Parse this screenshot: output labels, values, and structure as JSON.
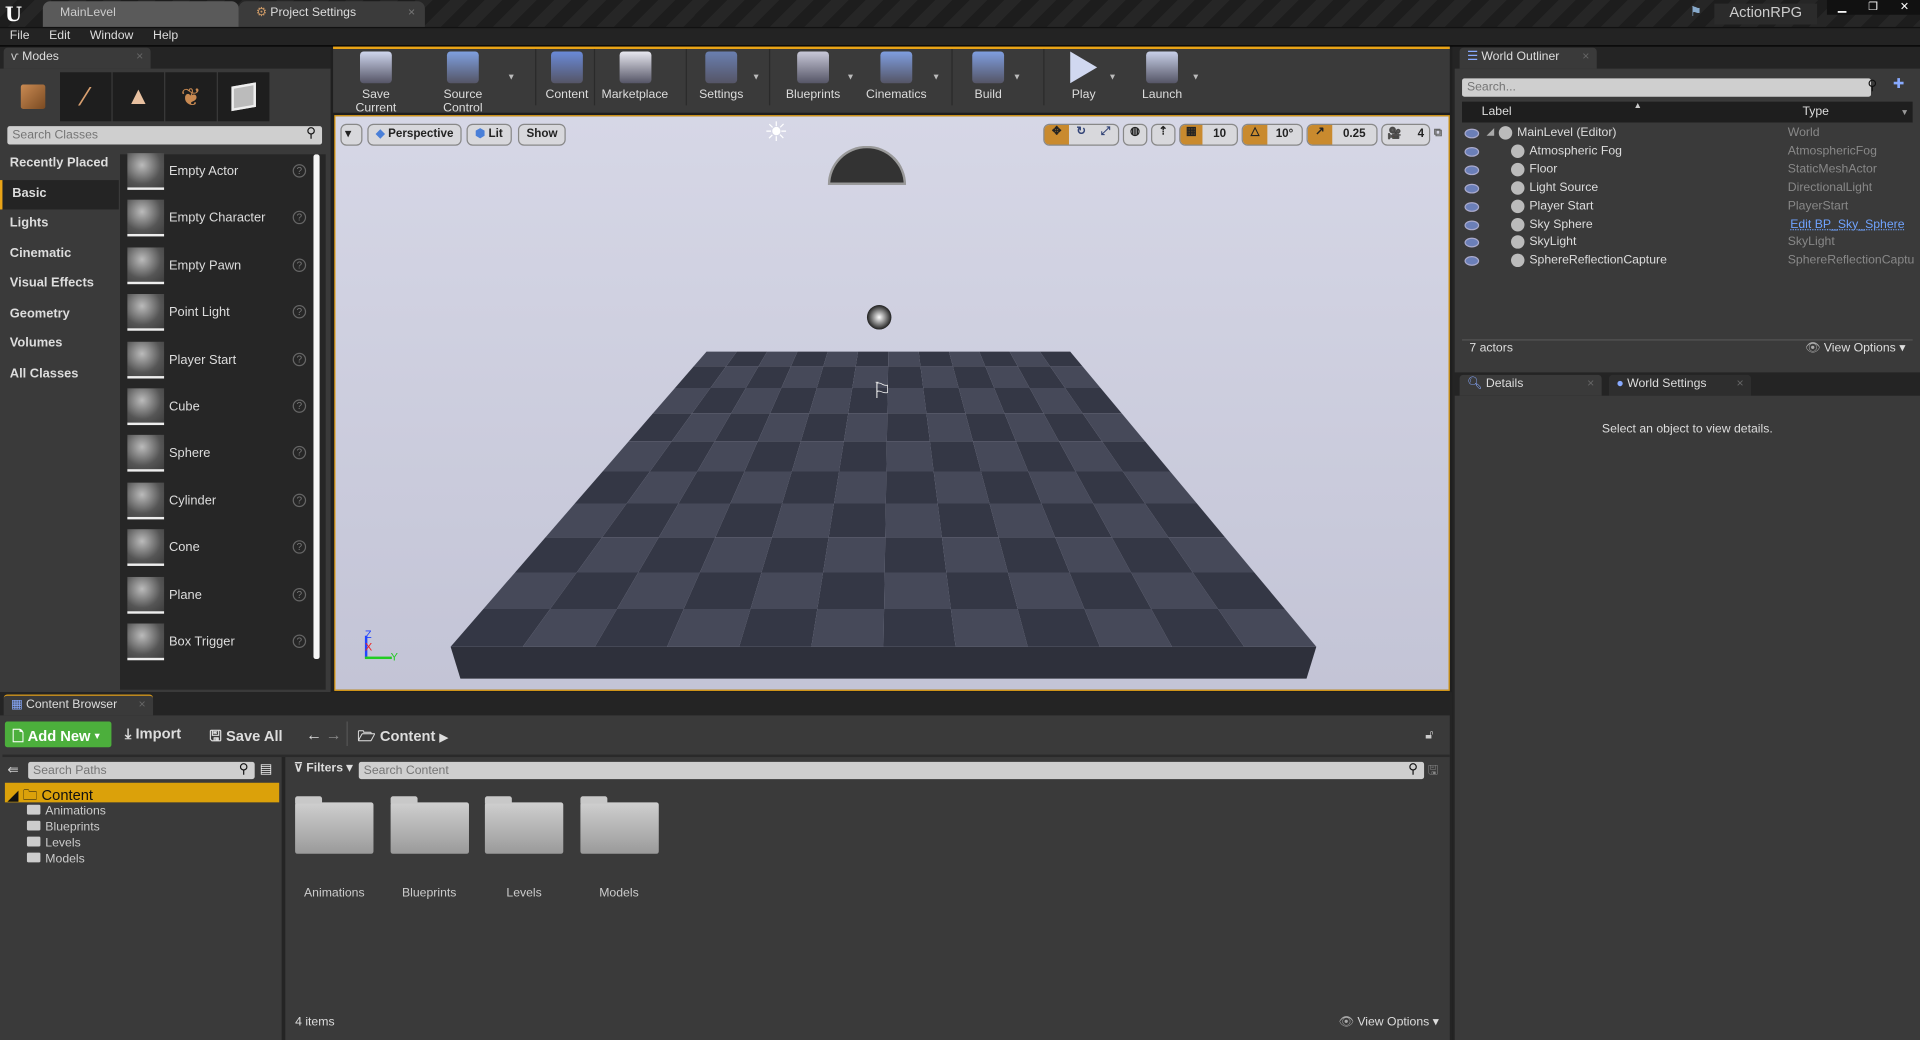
{
  "window": {
    "doc_tabs": [
      "MainLevel",
      "Project Settings"
    ],
    "project_name": "ActionRPG"
  },
  "menu": [
    "File",
    "Edit",
    "Window",
    "Help"
  ],
  "modes": {
    "tab": "Modes",
    "search_placeholder": "Search Classes",
    "categories": [
      "Recently Placed",
      "Basic",
      "Lights",
      "Cinematic",
      "Visual Effects",
      "Geometry",
      "Volumes",
      "All Classes"
    ],
    "selected_category": "Basic",
    "items": [
      "Empty Actor",
      "Empty Character",
      "Empty Pawn",
      "Point Light",
      "Player Start",
      "Cube",
      "Sphere",
      "Cylinder",
      "Cone",
      "Plane",
      "Box Trigger"
    ]
  },
  "toolbar": [
    "Save Current",
    "Source Control",
    "Content",
    "Marketplace",
    "Settings",
    "Blueprints",
    "Cinematics",
    "Build",
    "Play",
    "Launch"
  ],
  "viewport": {
    "perspective": "Perspective",
    "lit": "Lit",
    "show": "Show",
    "grid_snap": "10",
    "rotation_snap": "10°",
    "scale_snap": "0.25",
    "camera_speed": "4",
    "axis": {
      "z": "Z",
      "x": "X",
      "y": "Y"
    },
    "accent": "#e8a317"
  },
  "outliner": {
    "tab": "World Outliner",
    "search_placeholder": "Search...",
    "columns": [
      "Label",
      "Type"
    ],
    "rows": [
      {
        "label": "MainLevel (Editor)",
        "type": "World"
      },
      {
        "label": "Atmospheric Fog",
        "type": "AtmosphericFog"
      },
      {
        "label": "Floor",
        "type": "StaticMeshActor"
      },
      {
        "label": "Light Source",
        "type": "DirectionalLight"
      },
      {
        "label": "Player Start",
        "type": "PlayerStart"
      },
      {
        "label": "Sky Sphere",
        "type": "Edit BP_Sky_Sphere"
      },
      {
        "label": "SkyLight",
        "type": "SkyLight"
      },
      {
        "label": "SphereReflectionCapture",
        "type": "SphereReflectionCaptu"
      }
    ],
    "count": "7 actors",
    "view_options": "View Options"
  },
  "details": {
    "tabs": [
      "Details",
      "World Settings"
    ],
    "empty": "Select an object to view details."
  },
  "content_browser": {
    "tab": "Content Browser",
    "add_new": "Add New",
    "import": "Import",
    "save_all": "Save All",
    "path": "Content",
    "search_paths": "Search Paths",
    "filters": "Filters",
    "search_content": "Search Content",
    "tree_root": "Content",
    "tree": [
      "Animations",
      "Blueprints",
      "Levels",
      "Models"
    ],
    "folders": [
      "Animations",
      "Blueprints",
      "Levels",
      "Models"
    ],
    "count": "4 items",
    "view_options": "View Options",
    "add_new_color": "#4caf3c",
    "selected_color": "#dba10a"
  }
}
